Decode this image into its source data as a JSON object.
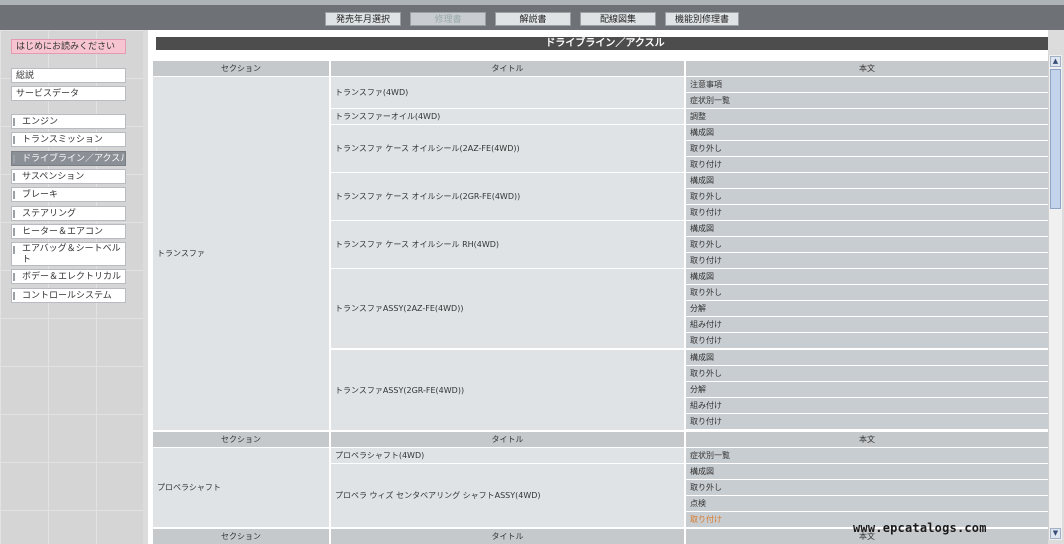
{
  "nav": {
    "buttons": [
      {
        "label": "発売年月選択"
      },
      {
        "label": "修理書"
      },
      {
        "label": "解説書"
      },
      {
        "label": "配線図集"
      },
      {
        "label": "機能別修理書"
      }
    ]
  },
  "sidebar": {
    "top": [
      "はじめにお読みください"
    ],
    "general": [
      "総説",
      "サービスデータ"
    ],
    "items": [
      "エンジン",
      "トランスミッション",
      "ドライブライン／アクスル",
      "サスペンション",
      "ブレーキ",
      "ステアリング",
      "ヒーター＆エアコン",
      "エアバッグ＆シートベルト",
      "ボデー＆エレクトリカル",
      "コントロールシステム"
    ]
  },
  "page": {
    "title": "ドライブライン／アクスル"
  },
  "table": {
    "headers": [
      "セクション",
      "タイトル",
      "本文"
    ],
    "sections": [
      {
        "name": "トランスファ",
        "titles": [
          {
            "title": "トランスファ(4WD)",
            "items": [
              "注意事項",
              "症状別一覧"
            ]
          },
          {
            "title": "トランスファーオイル(4WD)",
            "items": [
              "調整"
            ]
          },
          {
            "title": "トランスファ ケース オイルシール(2AZ-FE(4WD))",
            "items": [
              "構成図",
              "取り外し",
              "取り付け"
            ]
          },
          {
            "title": "トランスファ ケース オイルシール(2GR-FE(4WD))",
            "items": [
              "構成図",
              "取り外し",
              "取り付け"
            ]
          },
          {
            "title": "トランスファ ケース オイルシール RH(4WD)",
            "items": [
              "構成図",
              "取り外し",
              "取り付け"
            ]
          },
          {
            "title": "トランスファASSY(2AZ-FE(4WD))",
            "items": [
              "構成図",
              "取り外し",
              "分解",
              "組み付け",
              "取り付け"
            ]
          },
          {
            "title": "トランスファASSY(2GR-FE(4WD))",
            "items": [
              "構成図",
              "取り外し",
              "分解",
              "組み付け",
              "取り付け"
            ]
          }
        ]
      },
      {
        "name": "プロペラシャフト",
        "titles": [
          {
            "title": "プロペラシャフト(4WD)",
            "items": [
              "症状別一覧"
            ]
          },
          {
            "title": "プロペラ ウィズ センタベアリング シャフトASSY(4WD)",
            "items": [
              "構成図",
              "取り外し",
              "点検",
              "取り付け"
            ]
          }
        ]
      },
      {
        "name": "",
        "titles": []
      }
    ]
  },
  "watermark": "www.epcatalogs.com",
  "colors": {
    "accent": "#d9792a",
    "header_bar": "#4d4d4d",
    "selected": "#8b9097"
  }
}
